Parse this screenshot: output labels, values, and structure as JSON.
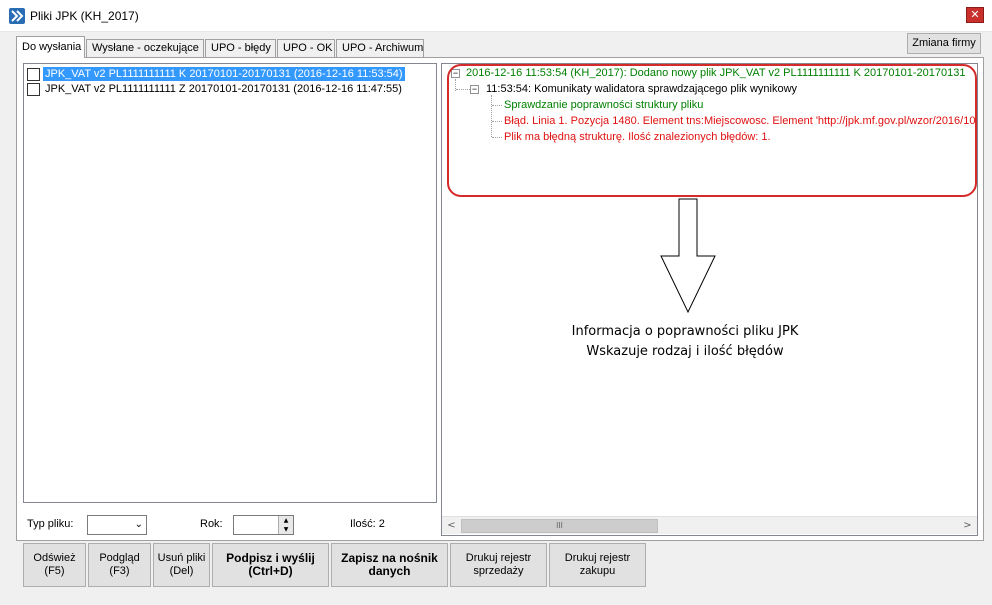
{
  "window": {
    "title": "Pliki JPK (KH_2017)",
    "close_label": "✕",
    "change_company_label": "Zmiana firmy"
  },
  "tabs": [
    {
      "label": "Do wysłania",
      "active": true
    },
    {
      "label": "Wysłane - oczekujące",
      "active": false
    },
    {
      "label": "UPO - błędy",
      "active": false
    },
    {
      "label": "UPO - OK",
      "active": false
    },
    {
      "label": "UPO - Archiwum",
      "active": false
    }
  ],
  "file_list": [
    {
      "label": "JPK_VAT v2  PL1111111111 K 20170101-20170131 (2016-12-16 11:53:54)",
      "checked": false,
      "selected": true
    },
    {
      "label": "JPK_VAT v2  PL1111111111 Z 20170101-20170131 (2016-12-16 11:47:55)",
      "checked": false,
      "selected": false
    }
  ],
  "log": {
    "root": "2016-12-16 11:53:54 (KH_2017): Dodano nowy plik JPK_VAT v2  PL1111111111 K 20170101-20170131",
    "child": "11:53:54: Komunikaty walidatora sprawdzającego plik wynikowy",
    "entries": [
      "Sprawdzanie poprawności struktury pliku",
      "Błąd. Linia 1. Pozycja 1480. Element tns:Miejscowosc. Element 'http://jpk.mf.gov.pl/wzor/2016/10/",
      "Plik ma błędną strukturę. Ilość znalezionych błędów: 1."
    ],
    "colors": {
      "ok": "#008000",
      "error": "#e01010",
      "highlight": "#d42a2a"
    }
  },
  "annotation": {
    "line1": "Informacja o poprawności pliku JPK",
    "line2": "Wskazuje rodzaj i ilość błędów"
  },
  "filters": {
    "file_type_label": "Typ pliku:",
    "file_type_value": "",
    "year_label": "Rok:",
    "year_value": "",
    "count_label": "Ilość: 2"
  },
  "scrollbar": {
    "left_arrow": "<",
    "right_arrow": ">",
    "thumb_grip": "III"
  },
  "buttons": {
    "refresh": {
      "line1": "Odśwież",
      "line2": "(F5)"
    },
    "preview": {
      "line1": "Podgląd",
      "line2": "(F3)"
    },
    "delete": {
      "line1": "Usuń pliki",
      "line2": "(Del)"
    },
    "sign_send": {
      "line1": "Podpisz i wyślij",
      "line2": "(Ctrl+D)"
    },
    "save_media": {
      "line1": "Zapisz na nośnik",
      "line2": "danych"
    },
    "print_sales": {
      "line1": "Drukuj rejestr",
      "line2": "sprzedaży"
    },
    "print_purchase": {
      "line1": "Drukuj rejestr",
      "line2": "zakupu"
    }
  }
}
